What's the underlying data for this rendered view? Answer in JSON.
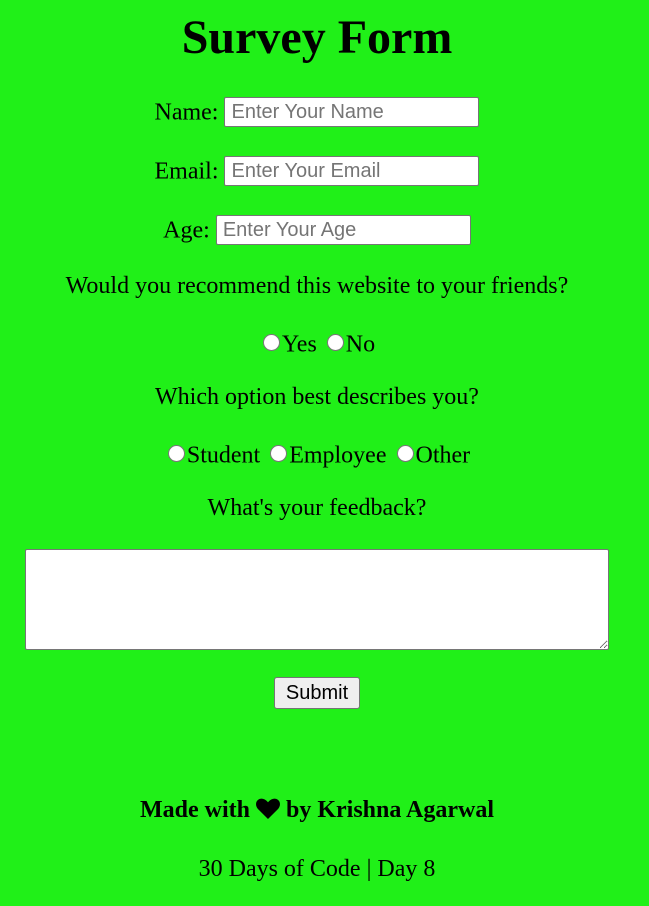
{
  "form": {
    "title": "Survey Form",
    "name": {
      "label": "Name:",
      "placeholder": "Enter Your Name",
      "value": ""
    },
    "email": {
      "label": "Email:",
      "placeholder": "Enter Your Email",
      "value": ""
    },
    "age": {
      "label": "Age:",
      "placeholder": "Enter Your Age",
      "value": ""
    },
    "recommend": {
      "question": "Would you recommend this website to your friends?",
      "options": [
        "Yes",
        "No"
      ]
    },
    "describe": {
      "question": "Which option best describes you?",
      "options": [
        "Student",
        "Employee",
        "Other"
      ]
    },
    "feedback": {
      "question": "What's your feedback?",
      "value": ""
    },
    "submit_label": "Submit"
  },
  "footer": {
    "made_prefix": "Made with",
    "heart_icon": "heart-icon",
    "made_suffix": "by Krishna Agarwal",
    "day_text": "30 Days of Code | Day 8"
  }
}
